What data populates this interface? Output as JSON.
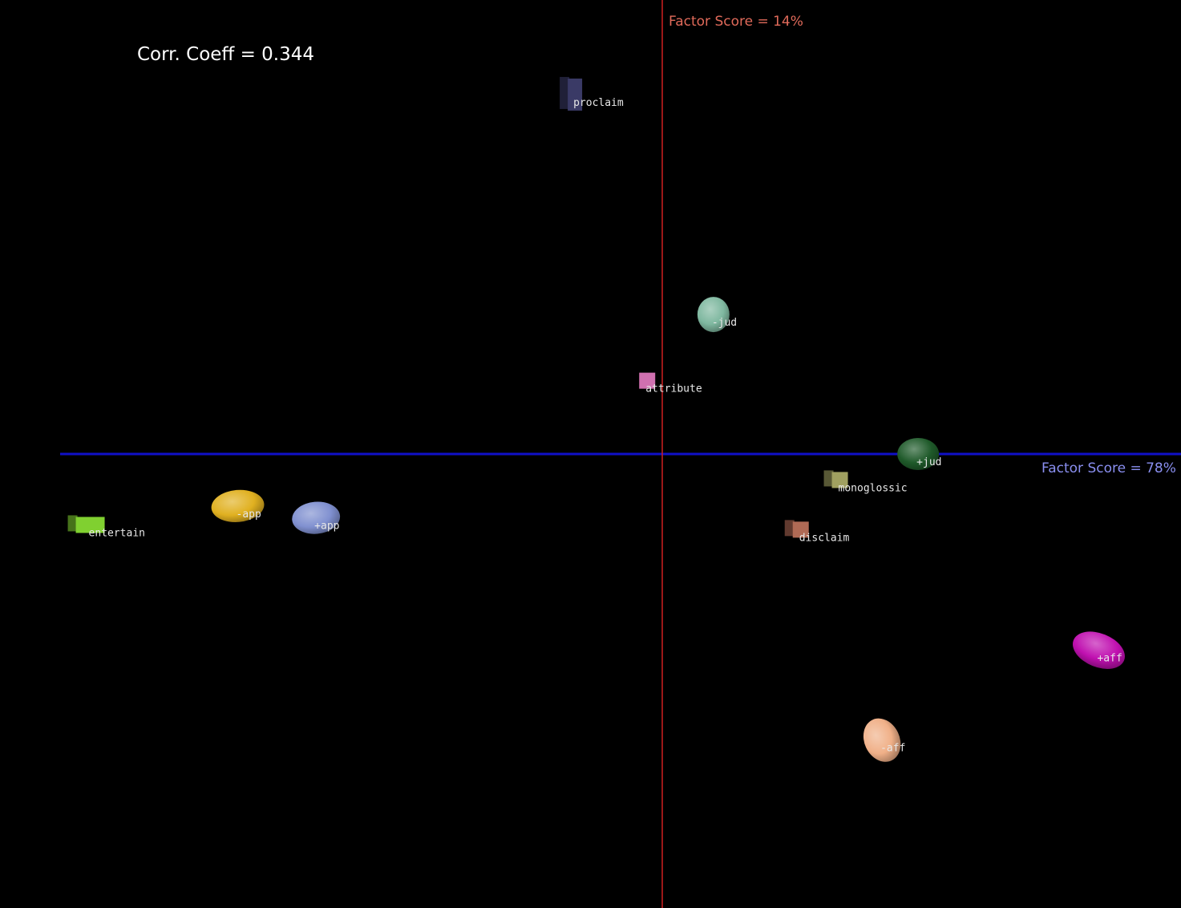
{
  "corr_text": "Corr. Coeff = 0.344",
  "chart_data": {
    "type": "scatter",
    "xlabel": "Factor Score = 78%",
    "ylabel": "Factor Score = 14%",
    "xlim": [
      -1.0,
      0.82
    ],
    "ylim": [
      -0.92,
      0.96
    ],
    "grid": false,
    "legend": "none",
    "axis_colors": {
      "x": "#1010c8",
      "y": "#d02020"
    },
    "points": [
      {
        "label": "proclaim",
        "x": -0.145,
        "y": 0.76,
        "shape": "cube",
        "color": "#3a3a66"
      },
      {
        "label": "-jud",
        "x": 0.085,
        "y": 0.295,
        "shape": "ellipse",
        "color": "#7fb8a0"
      },
      {
        "label": "attribute",
        "x": -0.025,
        "y": 0.155,
        "shape": "square",
        "color": "#d070b0"
      },
      {
        "label": "+jud",
        "x": 0.425,
        "y": 0.0,
        "shape": "ellipse",
        "color": "#1f5a2a"
      },
      {
        "label": "monoglossic",
        "x": 0.295,
        "y": -0.055,
        "shape": "cube",
        "color": "#a0a060"
      },
      {
        "label": "disclaim",
        "x": 0.23,
        "y": -0.16,
        "shape": "cube",
        "color": "#b06a55"
      },
      {
        "label": "-app",
        "x": -0.705,
        "y": -0.11,
        "shape": "ellipse",
        "color": "#e0b020"
      },
      {
        "label": "+app",
        "x": -0.575,
        "y": -0.135,
        "shape": "ellipse",
        "color": "#8090d0"
      },
      {
        "label": "entertain",
        "x": -0.95,
        "y": -0.15,
        "shape": "cube",
        "color": "#80d030"
      },
      {
        "label": "+aff",
        "x": 0.725,
        "y": -0.415,
        "shape": "ellipse",
        "color": "#c010b0"
      },
      {
        "label": "-aff",
        "x": 0.365,
        "y": -0.605,
        "shape": "ellipse",
        "color": "#f0b088"
      }
    ]
  }
}
